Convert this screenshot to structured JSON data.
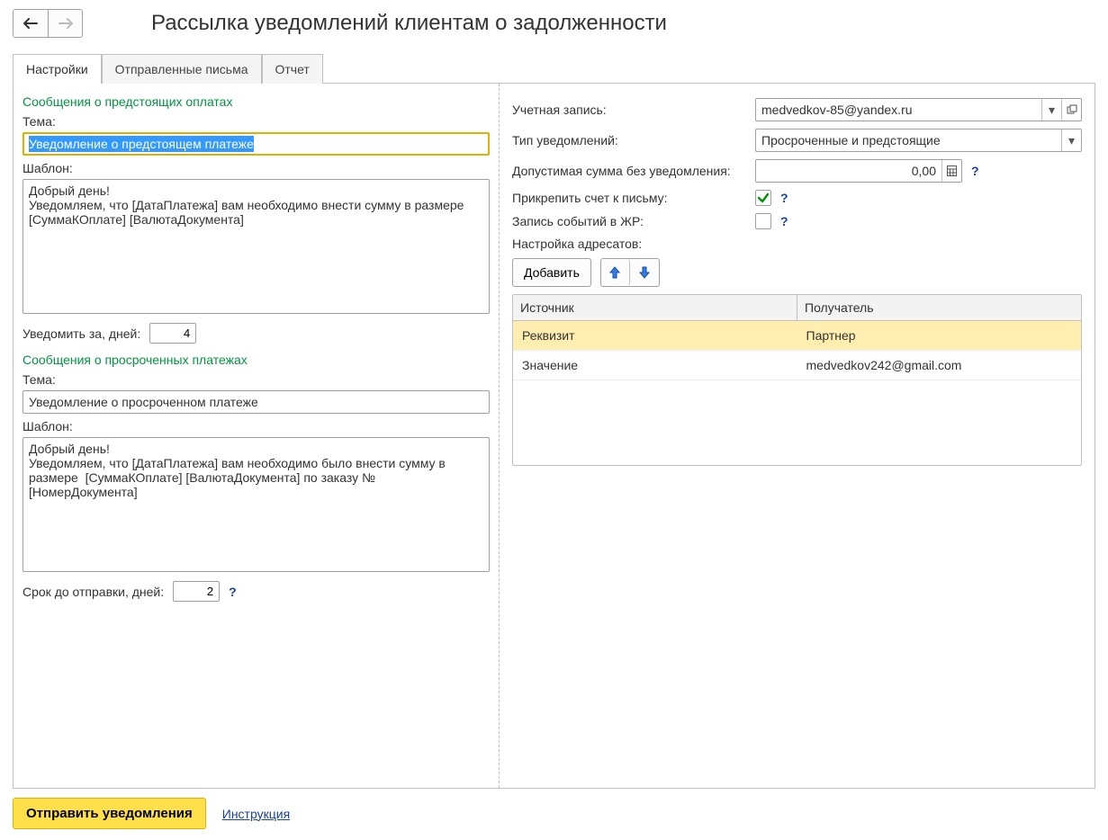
{
  "title": "Рассылка уведомлений клиентам о задолженности",
  "tabs": {
    "settings": "Настройки",
    "sent": "Отправленные письма",
    "report": "Отчет"
  },
  "left": {
    "upcoming_header": "Сообщения о предстоящих оплатах",
    "subject_label": "Тема:",
    "upcoming_subject": "Уведомление о предстоящем платеже",
    "template_label": "Шаблон:",
    "upcoming_template": "Добрый день!\nУведомляем, что [ДатаПлатежа] вам необходимо внести сумму в размере  [СуммаКОплате] [ВалютаДокумента]",
    "notify_days_label": "Уведомить за, дней:",
    "notify_days_value": "4",
    "overdue_header": "Сообщения о просроченных платежах",
    "overdue_subject": "Уведомление о просроченном платеже",
    "overdue_template": "Добрый день!\nУведомляем, что [ДатаПлатежа] вам необходимо было внести сумму в размере  [СуммаКОплате] [ВалютаДокумента] по заказу №[НомерДокумента]",
    "send_days_label": "Срок до отправки, дней:",
    "send_days_value": "2"
  },
  "right": {
    "account_label": "Учетная запись:",
    "account_value": "medvedkov-85@yandex.ru",
    "type_label": "Тип уведомлений:",
    "type_value": "Просроченные и предстоящие",
    "threshold_label": "Допустимая сумма без уведомления:",
    "threshold_value": "0,00",
    "attach_label": "Прикрепить счет к письму:",
    "log_label": "Запись событий в ЖР:",
    "recipients_label": "Настройка адресатов:",
    "add_button": "Добавить",
    "grid": {
      "col1": "Источник",
      "col2": "Получатель",
      "rows": [
        {
          "c1": "Реквизит",
          "c2": "Партнер",
          "selected": true
        },
        {
          "c1": "Значение",
          "c2": "medvedkov242@gmail.com",
          "selected": false
        }
      ]
    }
  },
  "footer": {
    "send": "Отправить уведомления",
    "help": "Инструкция"
  }
}
